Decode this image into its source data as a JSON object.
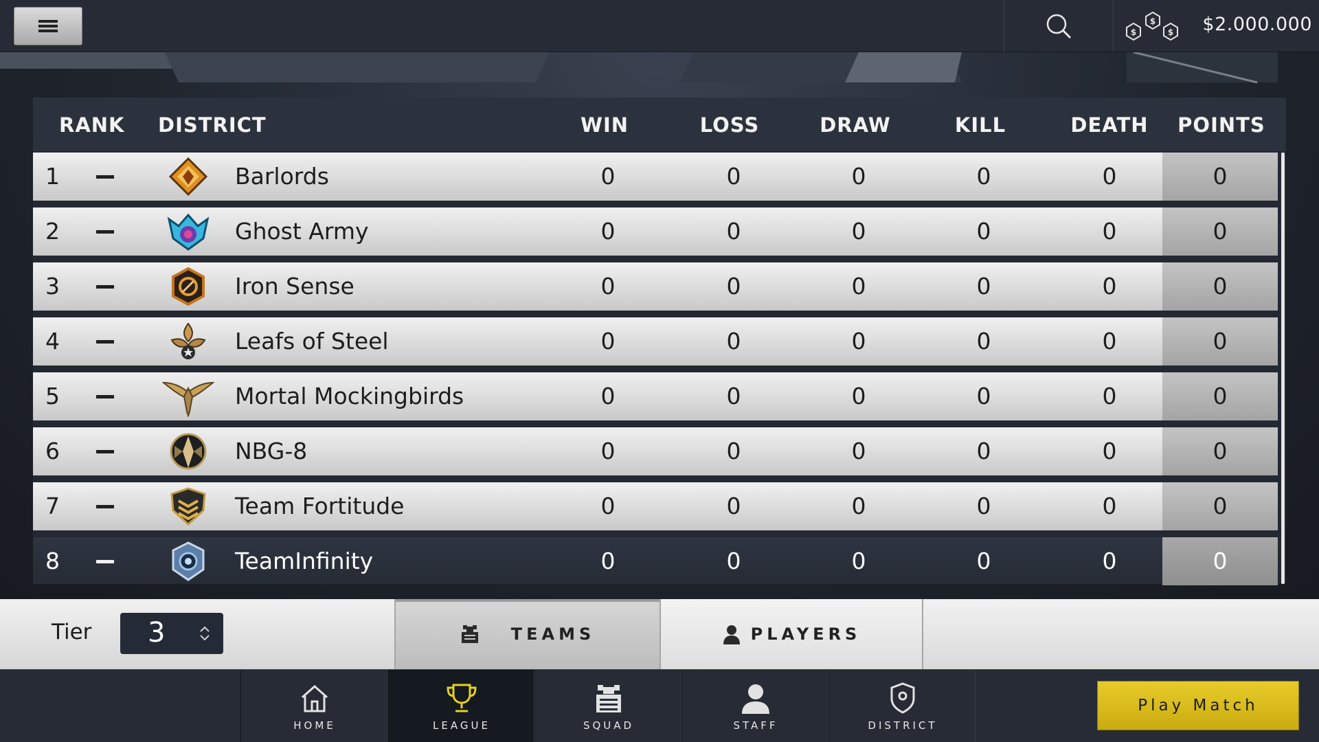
{
  "header": {
    "menu_icon": "hamburger-icon",
    "search_icon": "search-icon",
    "currency_icon": "coins-icon",
    "money": "$2.000.000"
  },
  "table": {
    "columns": [
      "RANK",
      "DISTRICT",
      "WIN",
      "LOSS",
      "DRAW",
      "KILL",
      "DEATH",
      "POINTS"
    ],
    "rows": [
      {
        "rank": "1",
        "team": "Barlords",
        "emblem": "barlords-emblem-icon",
        "win": "0",
        "loss": "0",
        "draw": "0",
        "kill": "0",
        "death": "0",
        "points": "0"
      },
      {
        "rank": "2",
        "team": "Ghost Army",
        "emblem": "ghost-army-emblem-icon",
        "win": "0",
        "loss": "0",
        "draw": "0",
        "kill": "0",
        "death": "0",
        "points": "0"
      },
      {
        "rank": "3",
        "team": "Iron Sense",
        "emblem": "iron-sense-emblem-icon",
        "win": "0",
        "loss": "0",
        "draw": "0",
        "kill": "0",
        "death": "0",
        "points": "0"
      },
      {
        "rank": "4",
        "team": "Leafs of Steel",
        "emblem": "leafs-of-steel-emblem-icon",
        "win": "0",
        "loss": "0",
        "draw": "0",
        "kill": "0",
        "death": "0",
        "points": "0"
      },
      {
        "rank": "5",
        "team": "Mortal Mockingbirds",
        "emblem": "mortal-mockingbirds-emblem-icon",
        "win": "0",
        "loss": "0",
        "draw": "0",
        "kill": "0",
        "death": "0",
        "points": "0"
      },
      {
        "rank": "6",
        "team": "NBG-8",
        "emblem": "nbg-8-emblem-icon",
        "win": "0",
        "loss": "0",
        "draw": "0",
        "kill": "0",
        "death": "0",
        "points": "0"
      },
      {
        "rank": "7",
        "team": "Team Fortitude",
        "emblem": "team-fortitude-emblem-icon",
        "win": "0",
        "loss": "0",
        "draw": "0",
        "kill": "0",
        "death": "0",
        "points": "0"
      },
      {
        "rank": "8",
        "team": "TeamInfinity",
        "emblem": "teaminfinity-emblem-icon",
        "win": "0",
        "loss": "0",
        "draw": "0",
        "kill": "0",
        "death": "0",
        "points": "0"
      }
    ]
  },
  "filters": {
    "tier_label": "Tier",
    "tier_value": "3",
    "tabs": [
      {
        "label": "TEAMS",
        "icon": "teams-icon",
        "active": true
      },
      {
        "label": "PLAYERS",
        "icon": "person-icon",
        "active": false
      }
    ]
  },
  "nav": {
    "items": [
      {
        "label": "HOME",
        "icon": "home-icon"
      },
      {
        "label": "LEAGUE",
        "icon": "trophy-icon",
        "active": true
      },
      {
        "label": "SQUAD",
        "icon": "squad-icon"
      },
      {
        "label": "STAFF",
        "icon": "staff-icon"
      },
      {
        "label": "DISTRICT",
        "icon": "shield-icon"
      }
    ],
    "play_label": "Play Match"
  },
  "colors": {
    "accent_yellow": "#e0c21f",
    "active_trophy": "#e7d21e",
    "dark_bg": "#262b35"
  }
}
